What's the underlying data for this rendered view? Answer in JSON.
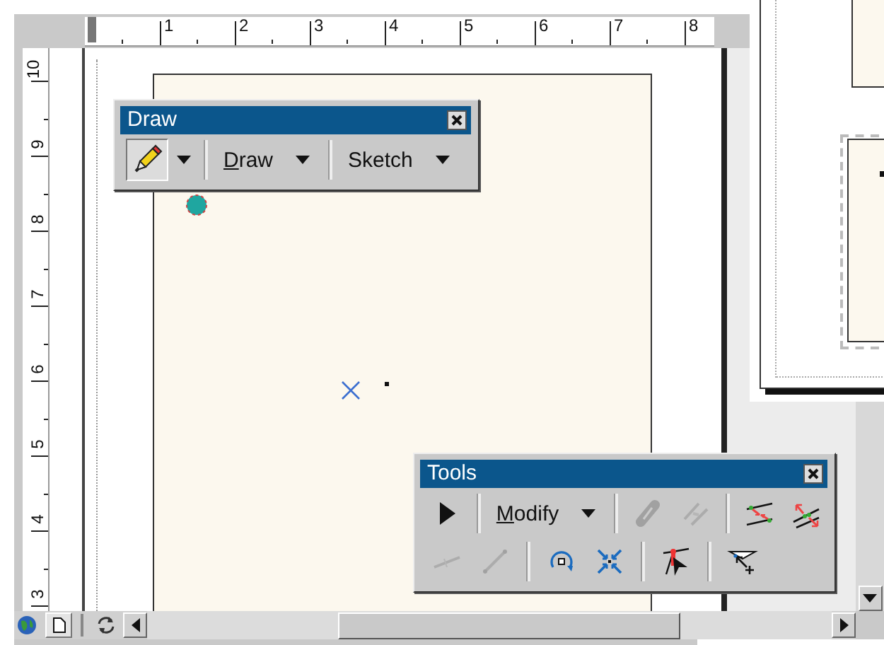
{
  "top_ruler": {
    "labels": [
      "1",
      "2",
      "3",
      "4",
      "5",
      "6",
      "7",
      "8"
    ]
  },
  "left_ruler": {
    "labels": [
      "10",
      "9",
      "8",
      "7",
      "6",
      "5",
      "4",
      "3"
    ]
  },
  "draw_toolbar": {
    "title": "Draw",
    "rows": [
      [
        {
          "kind": "tool",
          "selected": true,
          "dropdown": true
        },
        {
          "kind": "separator"
        },
        {
          "kind": "menu",
          "label": "Draw",
          "underline_first": true
        },
        {
          "kind": "separator"
        },
        {
          "kind": "menu",
          "label": "Sketch",
          "underline_first": false
        }
      ]
    ]
  },
  "tools_toolbar": {
    "title": "Tools",
    "rows": [
      [
        {
          "kind": "tool",
          "disabled": false
        },
        {
          "kind": "separator"
        },
        {
          "kind": "menu",
          "label": "Modify",
          "underline_first": true
        },
        {
          "kind": "separator"
        },
        {
          "kind": "tool",
          "disabled": true
        },
        {
          "kind": "tool",
          "disabled": true
        },
        {
          "kind": "separator"
        },
        {
          "kind": "tool",
          "disabled": false
        },
        {
          "kind": "tool",
          "disabled": false
        }
      ],
      [
        {
          "kind": "tool",
          "disabled": true
        },
        {
          "kind": "tool",
          "disabled": true
        },
        {
          "kind": "separator"
        },
        {
          "kind": "tool",
          "disabled": false
        },
        {
          "kind": "tool",
          "disabled": false
        },
        {
          "kind": "separator"
        },
        {
          "kind": "tool",
          "disabled": false
        },
        {
          "kind": "separator"
        },
        {
          "kind": "tool",
          "disabled": false
        }
      ]
    ]
  }
}
